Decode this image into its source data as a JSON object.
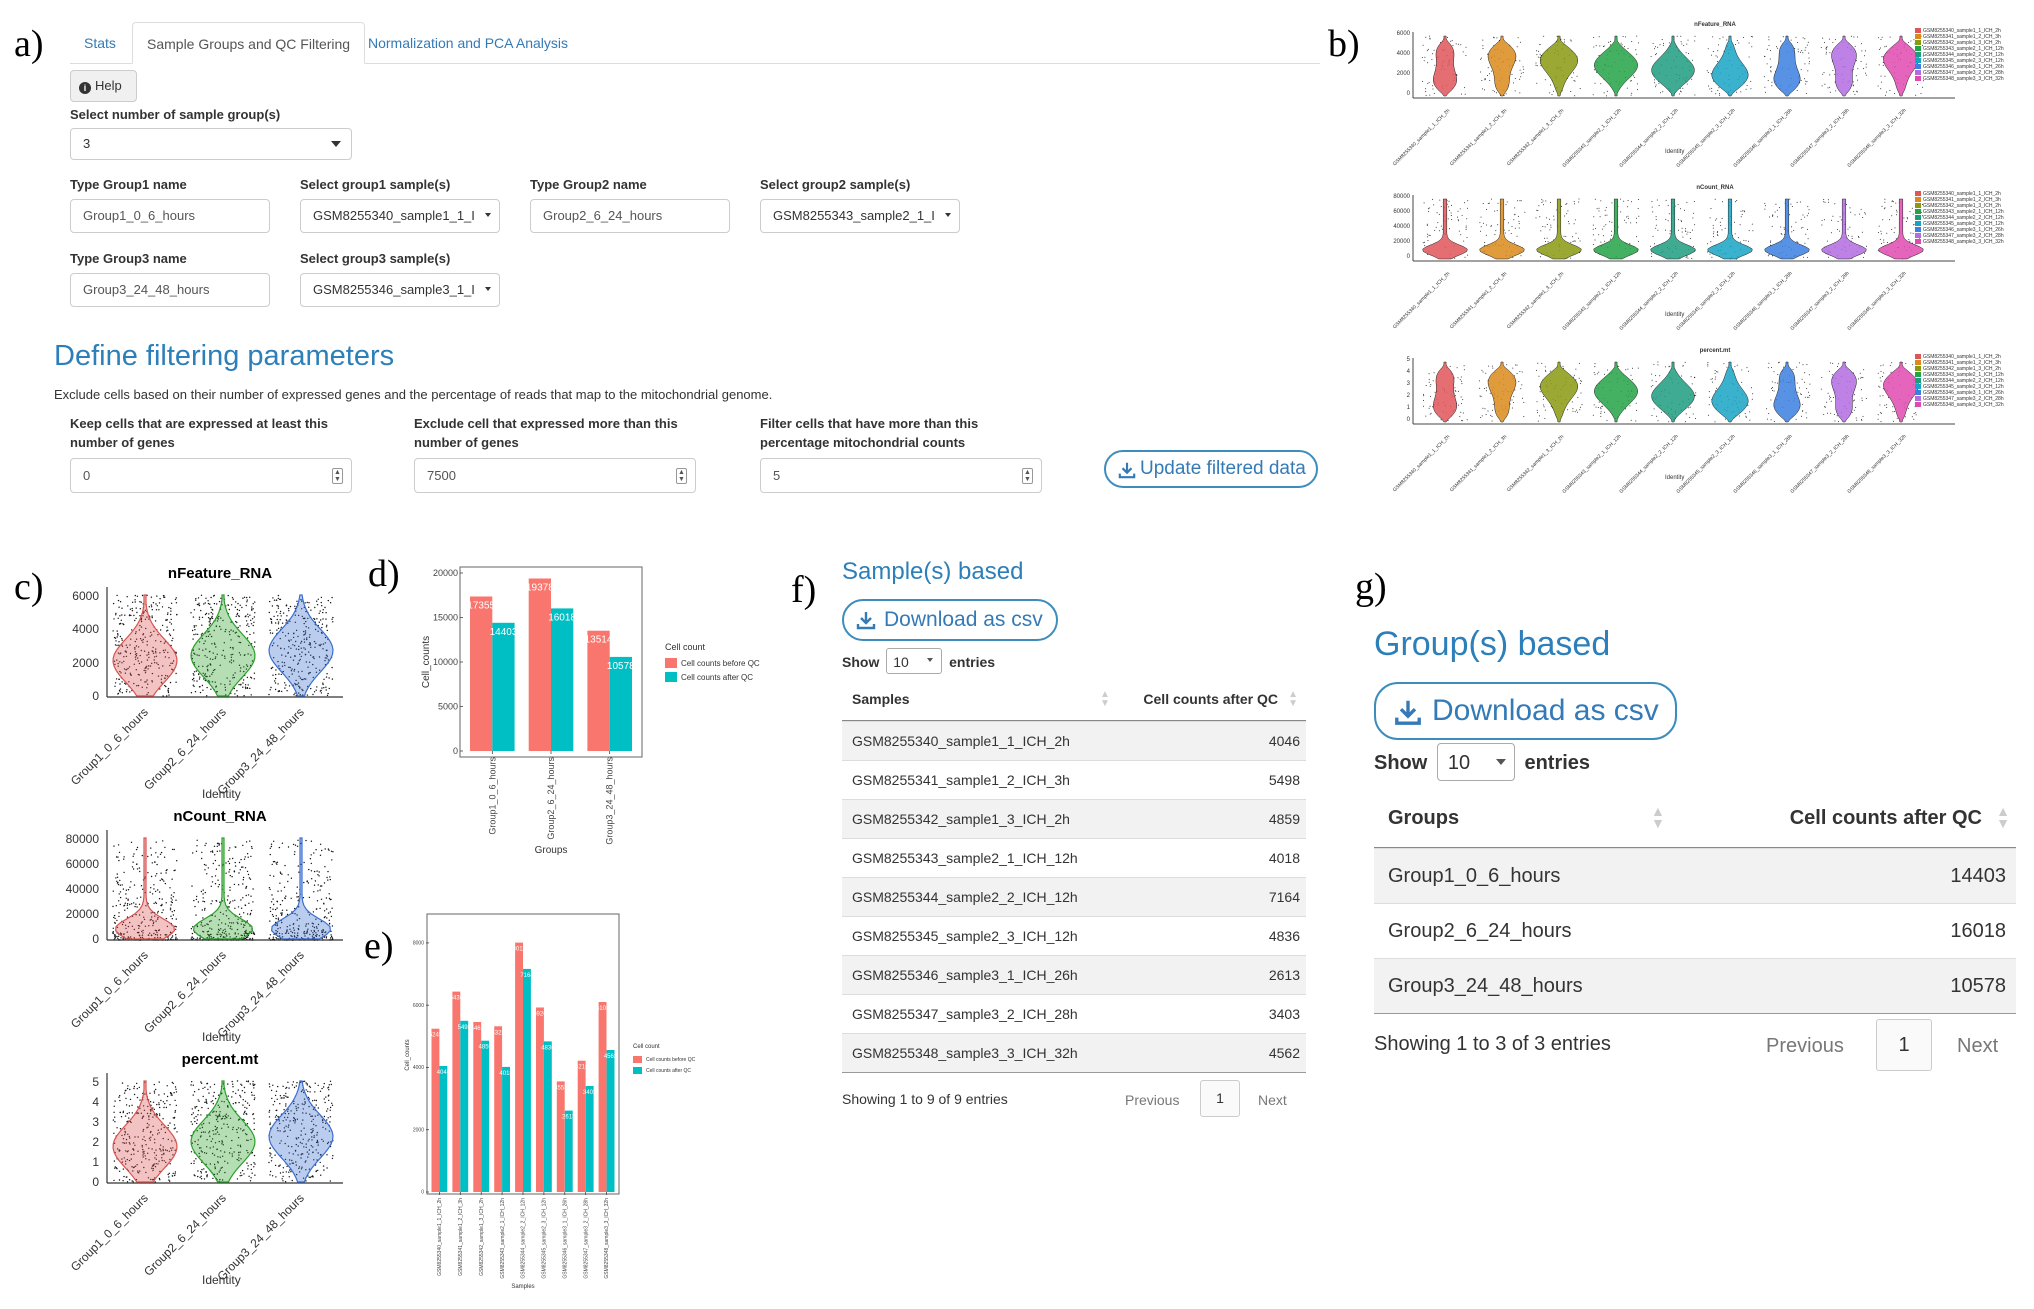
{
  "panel_labels": {
    "a": "a)",
    "b": "b)",
    "c": "c)",
    "d": "d)",
    "e": "e)",
    "f": "f)",
    "g": "g)"
  },
  "tabs": [
    {
      "label": "Stats"
    },
    {
      "label": "Sample Groups and QC Filtering"
    },
    {
      "label": "Normalization and PCA Analysis"
    }
  ],
  "help_label": "Help",
  "groups_form": {
    "num_groups_label": "Select number of sample group(s)",
    "num_groups_value": "3",
    "group1_name_label": "Type Group1 name",
    "group1_name_value": "Group1_0_6_hours",
    "group1_samples_label": "Select group1 sample(s)",
    "group1_samples_value": "GSM8255340_sample1_1_I",
    "group2_name_label": "Type Group2 name",
    "group2_name_value": "Group2_6_24_hours",
    "group2_samples_label": "Select group2 sample(s)",
    "group2_samples_value": "GSM8255343_sample2_1_I",
    "group3_name_label": "Type Group3 name",
    "group3_name_value": "Group3_24_48_hours",
    "group3_samples_label": "Select group3 sample(s)",
    "group3_samples_value": "GSM8255346_sample3_1_I"
  },
  "filtering": {
    "heading": "Define filtering parameters",
    "description": "Exclude cells based on their number of expressed genes and the percentage of reads that map to the mitochondrial genome.",
    "min_genes_label_1": "Keep cells that are expressed at least this",
    "min_genes_label_2": "number of genes",
    "min_genes_value": "0",
    "max_genes_label_1": "Exclude cell that expressed more than this",
    "max_genes_label_2": "number of genes",
    "max_genes_value": "7500",
    "mt_label_1": "Filter cells that have more than this",
    "mt_label_2": "percentage mitochondrial counts",
    "mt_value": "5",
    "update_button": "Update filtered data"
  },
  "panel_b": {
    "plots": [
      {
        "title": "nFeature_RNA",
        "yticks": [
          "6000",
          "4000",
          "2000",
          "0"
        ]
      },
      {
        "title": "nCount_RNA",
        "yticks": [
          "80000",
          "60000",
          "40000",
          "20000",
          "0"
        ]
      },
      {
        "title": "percent.mt",
        "yticks": [
          "5",
          "4",
          "3",
          "2",
          "1",
          "0"
        ]
      }
    ],
    "xlabel": "Identity",
    "samples": [
      "GSM8255340_sample1_1_ICH_2h",
      "GSM8255341_sample1_2_ICH_3h",
      "GSM8255342_sample1_3_ICH_2h",
      "GSM8255343_sample2_1_ICH_12h",
      "GSM8255344_sample2_2_ICH_12h",
      "GSM8255345_sample2_3_ICH_12h",
      "GSM8255346_sample3_1_ICH_26h",
      "GSM8255347_sample3_2_ICH_28h",
      "GSM8255348_sample3_3_ICH_32h"
    ],
    "colors": [
      "#e0555a",
      "#d98a1a",
      "#8a9a10",
      "#22a345",
      "#1f9c80",
      "#17a3c4",
      "#3b7fe0",
      "#b36be0",
      "#e04ab0"
    ]
  },
  "panel_c": {
    "plots": [
      {
        "title": "nFeature_RNA",
        "yticks": [
          "6000",
          "4000",
          "2000",
          "0"
        ]
      },
      {
        "title": "nCount_RNA",
        "yticks": [
          "80000",
          "60000",
          "40000",
          "20000",
          "0"
        ]
      },
      {
        "title": "percent.mt",
        "yticks": [
          "5",
          "4",
          "3",
          "2",
          "1",
          "0"
        ]
      }
    ],
    "groups": [
      "Group1_0_6_hours",
      "Group2_6_24_hours",
      "Group3_24_48_hours"
    ],
    "xlabel": "Identity",
    "colors": [
      "#d9534f",
      "#2aa02a",
      "#3b6fd1"
    ]
  },
  "chart_data": [
    {
      "type": "bar",
      "panel": "d",
      "categories": [
        "Group1_0_6_hours",
        "Group2_6_24_hours",
        "Group3_24_48_hours"
      ],
      "series": [
        {
          "name": "Cell counts before QC",
          "values": [
            17355,
            19378,
            13514
          ]
        },
        {
          "name": "Cell counts after QC",
          "values": [
            14403,
            16018,
            10578
          ]
        }
      ],
      "xlabel": "Groups",
      "ylabel": "Cell_counts",
      "yticks": [
        "20000",
        "15000",
        "10000",
        "5000",
        "0"
      ],
      "ylim": [
        0,
        20000
      ],
      "legend_title": "Cell count",
      "legend_position": "right",
      "colors": [
        "#f8766d",
        "#00bfc4"
      ]
    },
    {
      "type": "bar",
      "panel": "e",
      "categories": [
        "GSM8255340_sample1_1_ICH_2h",
        "GSM8255341_sample1_2_ICH_3h",
        "GSM8255342_sample1_3_ICH_2h",
        "GSM8255343_sample2_1_ICH_12h",
        "GSM8255344_sample2_2_ICH_12h",
        "GSM8255345_sample2_3_ICH_12h",
        "GSM8255346_sample3_1_ICH_26h",
        "GSM8255347_sample3_2_ICH_28h",
        "GSM8255348_sample3_3_ICH_32h"
      ],
      "series": [
        {
          "name": "Cell counts before QC",
          "values": [
            5245,
            6436,
            5461,
            5322,
            8011,
            5926,
            3553,
            4216,
            6103
          ]
        },
        {
          "name": "Cell counts after QC",
          "values": [
            4046,
            5498,
            4859,
            4018,
            7164,
            4836,
            2613,
            3403,
            4562
          ]
        }
      ],
      "xlabel": "Samples",
      "ylabel": "Cell_counts",
      "yticks": [
        "8000",
        "6000",
        "4000",
        "2000",
        "0"
      ],
      "ylim": [
        0,
        8800
      ],
      "legend_title": "Cell count",
      "legend_position": "right",
      "colors": [
        "#f8766d",
        "#00bfc4"
      ]
    }
  ],
  "table_samples": {
    "heading": "Sample(s) based",
    "download": "Download as csv",
    "show": "Show",
    "length": "10",
    "entries": "entries",
    "col1": "Samples",
    "col2": "Cell counts after QC",
    "rows": [
      {
        "name": "GSM8255340_sample1_1_ICH_2h",
        "count": "4046"
      },
      {
        "name": "GSM8255341_sample1_2_ICH_3h",
        "count": "5498"
      },
      {
        "name": "GSM8255342_sample1_3_ICH_2h",
        "count": "4859"
      },
      {
        "name": "GSM8255343_sample2_1_ICH_12h",
        "count": "4018"
      },
      {
        "name": "GSM8255344_sample2_2_ICH_12h",
        "count": "7164"
      },
      {
        "name": "GSM8255345_sample2_3_ICH_12h",
        "count": "4836"
      },
      {
        "name": "GSM8255346_sample3_1_ICH_26h",
        "count": "2613"
      },
      {
        "name": "GSM8255347_sample3_2_ICH_28h",
        "count": "3403"
      },
      {
        "name": "GSM8255348_sample3_3_ICH_32h",
        "count": "4562"
      }
    ],
    "info": "Showing 1 to 9 of 9 entries",
    "prev": "Previous",
    "page": "1",
    "next": "Next"
  },
  "table_groups": {
    "heading": "Group(s) based",
    "download": "Download as csv",
    "show": "Show",
    "length": "10",
    "entries": "entries",
    "col1": "Groups",
    "col2": "Cell counts after QC",
    "rows": [
      {
        "name": "Group1_0_6_hours",
        "count": "14403"
      },
      {
        "name": "Group2_6_24_hours",
        "count": "16018"
      },
      {
        "name": "Group3_24_48_hours",
        "count": "10578"
      }
    ],
    "info": "Showing 1 to 3 of 3 entries",
    "prev": "Previous",
    "page": "1",
    "next": "Next"
  }
}
